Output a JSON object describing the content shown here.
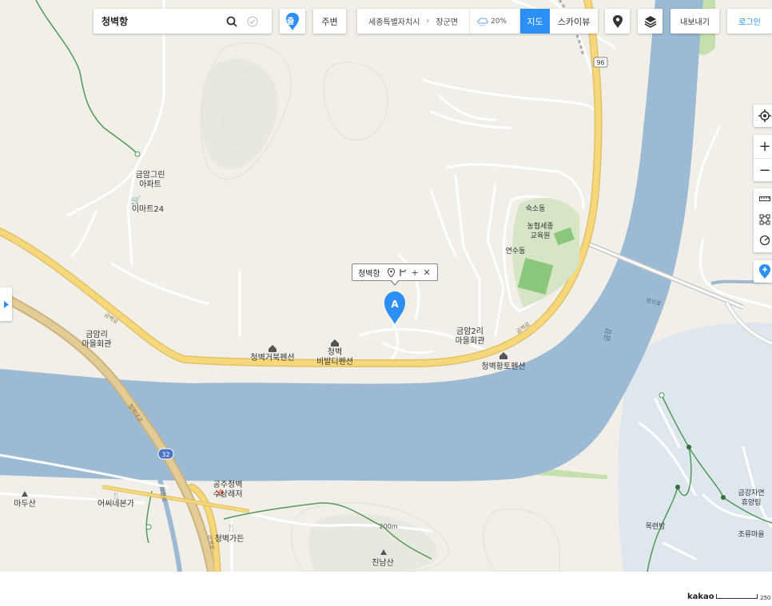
{
  "brand": {
    "logo": "kakaomap"
  },
  "search": {
    "value": "청벽항"
  },
  "depart": {
    "label": "출"
  },
  "nearby": {
    "label": "주변"
  },
  "region": {
    "level1": "세종특별자치시",
    "level2": "장군면",
    "weather": "20%"
  },
  "map_type": {
    "active": "지도",
    "other": "스카이뷰"
  },
  "toolbar": {
    "export_label": "내보내기",
    "login_label": "로그인"
  },
  "popup": {
    "name": "청벽항",
    "marker_letter": "A"
  },
  "map_labels": {
    "apt": "금암그린\n아파트",
    "emart": "이마트24",
    "geumamri": "금암리\n마을회관",
    "cheongbyeok_geobuk": "청벽거북펜션",
    "cheongbyeok_bibal": "청벽\n비발디펜션",
    "geumam2ri": "금암2리\n마을회관",
    "cheongbyeok_hwangto": "청벽황토펜션",
    "dorm": "숙소동",
    "nonghyup": "농협세종\n교육원",
    "training": "연수동",
    "maedusan": "마두산",
    "eossi": "어씨네본가",
    "gongju_leisure": "공주청벽\n수상레저",
    "cheongbyeok_garden": "청벽가든",
    "jinnamsan": "진남산",
    "alt_200": "200m",
    "geumgang_forest": "금강자연\n휴양림",
    "mokryeonbang": "목련방",
    "joryu": "조류마을",
    "river_geum": "금강",
    "route_96": "96",
    "route_32": "32",
    "road_geumbyeok": "금벽로",
    "road_geumbyeok_2": "금벽로",
    "road_cheongbyeok_bridge": "청벽대교",
    "road_mahyeon": "마현로",
    "road_jungbu": "금벽로",
    "road_ssangsin": "쌍신로"
  },
  "scale": {
    "brand": "kakao",
    "label": "250"
  },
  "colors": {
    "accent": "#2b8ff5",
    "water": "#9cbad3",
    "road_main": "#f6d77a",
    "forest": "#dfe7ee"
  }
}
